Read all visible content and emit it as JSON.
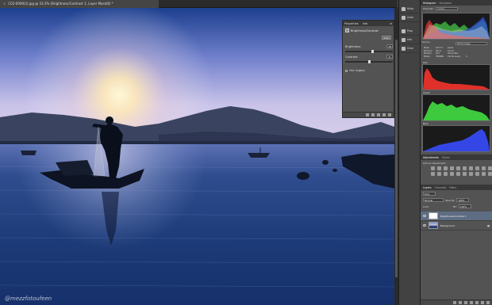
{
  "document": {
    "tab_title": "C02-0009(3).jpg @ 33.3% (Brightness/Contrast 1, Layer Mask/8) *",
    "close_glyph": "×",
    "watermark": "@mezzfotoufeen"
  },
  "properties": {
    "tabs": [
      "Properties",
      "Info"
    ],
    "adjustment_title": "Brightness/Contrast",
    "auto_label": "Auto",
    "brightness_label": "Brightness:",
    "brightness_value": "15",
    "brightness_level": 0.58,
    "contrast_label": "Contrast:",
    "contrast_value": "0",
    "contrast_level": 0.5,
    "use_legacy_label": "Use Legacy"
  },
  "icon_strip": {
    "items": [
      {
        "label": "Histo",
        "icon": "histogram-icon"
      },
      {
        "label": "Actio",
        "icon": "actions-icon"
      },
      {
        "label": "Prop",
        "icon": "properties-icon"
      },
      {
        "label": "Info",
        "icon": "info-icon"
      },
      {
        "label": "Chan",
        "icon": "channels-icon"
      }
    ]
  },
  "histogram": {
    "tabs": [
      "Histogram",
      "Navigator"
    ],
    "channel_label": "Channel:",
    "channel_value": "Colors",
    "source_label": "Source:",
    "source_value": "Entire Image",
    "stats": [
      [
        "Mean:",
        "103.77",
        "Level:",
        ""
      ],
      [
        "Std Dev:",
        "56.11",
        "Count:",
        ""
      ],
      [
        "Median:",
        "103",
        "Percentile:",
        ""
      ],
      [
        "Pixels:",
        "356868",
        "Cache Level:",
        "4"
      ]
    ],
    "channels": [
      "Red",
      "Green",
      "Blue"
    ]
  },
  "adjustments": {
    "tabs": [
      "Adjustments",
      "Styles"
    ],
    "add_label": "Add an adjustment",
    "icon_count": 20
  },
  "layers": {
    "tabs": [
      "Layers",
      "Channels",
      "Paths"
    ],
    "kind_label": "Kind",
    "blend_mode": "Normal",
    "opacity_label": "Opacity:",
    "opacity_value": "100%",
    "lock_label": "Lock:",
    "fill_label": "Fill:",
    "fill_value": "100%",
    "items": [
      {
        "name": "Brightness/Contrast 1",
        "selected": true,
        "thumb": "white",
        "locked": false
      },
      {
        "name": "Background",
        "selected": false,
        "thumb": "photo",
        "locked": true
      }
    ]
  },
  "colors": {
    "sky_top": "#1c3f8e",
    "sun": "#fff6d2",
    "water": "#24477f"
  }
}
